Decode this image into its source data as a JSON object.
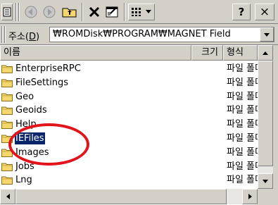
{
  "toolbar": {
    "buttons": [
      "app-menu",
      "back",
      "forward",
      "up-folder",
      "delete",
      "properties",
      "view-menu",
      "help",
      "close"
    ],
    "help_label": "?",
    "close_label": "×"
  },
  "address": {
    "label_prefix": "주소(",
    "label_key": "D",
    "label_suffix": ")",
    "path": "₩ROMDisk₩PROGRAM₩MAGNET Field"
  },
  "columns": {
    "name": "이름",
    "size": "크기",
    "type": "형식"
  },
  "files": [
    {
      "name": "EnterpriseRPC",
      "type": "파일 폴더"
    },
    {
      "name": "FileSettings",
      "type": "파일 폴더"
    },
    {
      "name": "Geo",
      "type": "파일 폴더"
    },
    {
      "name": "Geoids",
      "type": "파일 폴더"
    },
    {
      "name": "Help",
      "type": "파일 폴더"
    },
    {
      "name": "IEFiles",
      "type": "파일 폴더"
    },
    {
      "name": "Images",
      "type": "파일 폴더"
    },
    {
      "name": "Jobs",
      "type": "파일 폴더"
    },
    {
      "name": "Lng",
      "type": "파일 폴더"
    }
  ],
  "selected_index": 5,
  "colors": {
    "selection": "#0a246a",
    "highlight_circle": "#e0141a",
    "folder": "#f5d76e"
  }
}
